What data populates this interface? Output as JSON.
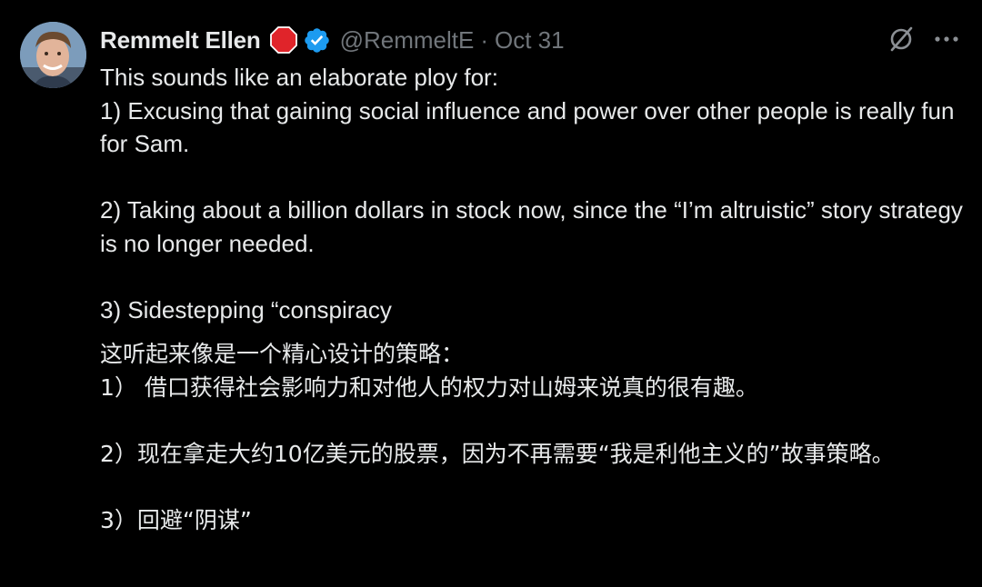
{
  "author": {
    "name": "Remmelt Ellen",
    "handle": "@RemmeltE",
    "separator": "·",
    "date": "Oct 31"
  },
  "icons": {
    "stop": "stop-sign-icon",
    "verified": "verified-badge-icon",
    "grok": "grok-icon",
    "more": "more-options-icon"
  },
  "colors": {
    "background": "#000000",
    "text": "#e7e9ea",
    "secondary_text": "#71767b",
    "verified_blue": "#1d9bf0",
    "stop_red": "#e0242a"
  },
  "tweet": {
    "original": [
      "This sounds like an elaborate ploy for:",
      "1) Excusing that gaining social influence and power over other people is really fun for Sam.",
      "2) Taking about a billion dollars in stock now, since the “I’m altruistic” story strategy is no longer needed.",
      "3) Sidestepping “conspiracy"
    ],
    "translation": [
      "这听起来像是一个精心设计的策略：",
      "1） 借口获得社会影响力和对他人的权力对山姆来说真的很有趣。",
      "2）现在拿走大约10亿美元的股票，因为不再需要“我是利他主义的”故事策略。",
      "3）回避“阴谋”"
    ]
  }
}
